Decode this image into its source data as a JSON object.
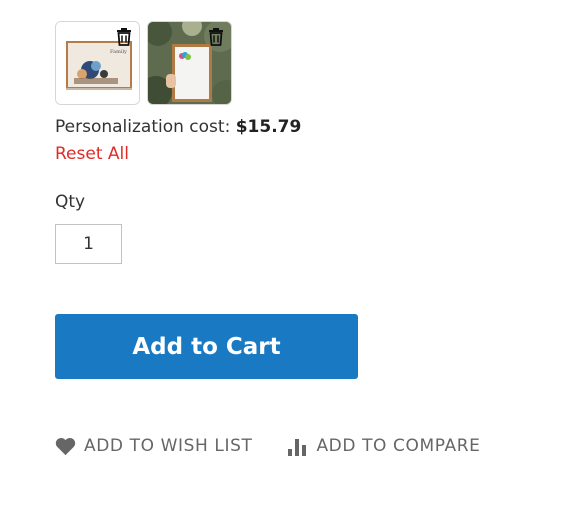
{
  "thumbnails": [
    {
      "icon": "framed-print-photo",
      "delete_icon": "trash-icon"
    },
    {
      "icon": "framed-print-held-photo",
      "delete_icon": "trash-icon"
    }
  ],
  "personalization": {
    "label": "Personalization cost:",
    "value": "$15.79"
  },
  "reset_label": "Reset All",
  "qty": {
    "label": "Qty",
    "value": "1"
  },
  "add_to_cart_label": "Add to Cart",
  "actions": {
    "wishlist_label": "Add to Wish List",
    "compare_label": "Add to Compare"
  },
  "colors": {
    "primary": "#1979c3",
    "reset": "#e02b27",
    "action_text": "#666666"
  }
}
